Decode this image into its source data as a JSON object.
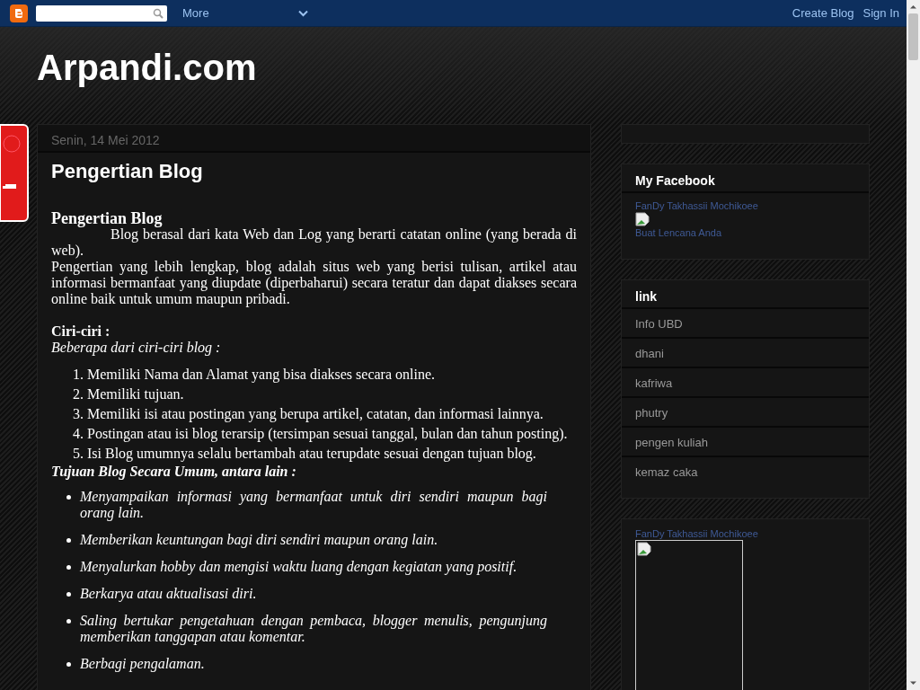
{
  "navbar": {
    "more": "More",
    "create_blog": "Create Blog",
    "sign_in": "Sign In"
  },
  "header": {
    "title": "Arpandi.com"
  },
  "post": {
    "date": "Senin, 14 Mei 2012",
    "title": "Pengertian Blog",
    "heading": "Pengertian Blog",
    "intro": "Blog berasal dari kata Web dan Log yang berarti catatan online (yang berada di web).",
    "paragraph": "Pengertian yang lebih lengkap, blog adalah situs web yang berisi tulisan, artikel atau informasi bermanfaat yang diupdate (diperbaharui) secara teratur dan dapat diakses secara online baik untuk umum maupun pribadi.",
    "features_heading": "Ciri-ciri :",
    "features_intro": "Beberapa dari ciri-ciri blog :",
    "features": [
      {
        "number": "1.",
        "text": "Memiliki Nama dan Alamat yang bisa diakses secara online."
      },
      {
        "number": "2.",
        "text": "Memiliki tujuan."
      },
      {
        "number": "3.",
        "text": "Memiliki isi atau postingan yang berupa artikel, catatan, dan informasi lainnya."
      },
      {
        "number": "4.",
        "text": "Postingan atau isi blog terarsip (tersimpan sesuai tanggal, bulan dan tahun posting)."
      },
      {
        "number": "5.",
        "text": "Isi Blog umumnya selalu bertambah atau terupdate sesuai dengan tujuan blog."
      }
    ],
    "goals_heading": "Tujuan Blog Secara Umum, antara lain :",
    "goals": [
      "Menyampaikan informasi yang bermanfaat untuk diri sendiri maupun bagi orang lain.",
      "Memberikan keuntungan bagi diri sendiri maupun orang lain.",
      "Menyalurkan hobby dan mengisi waktu luang dengan kegiatan yang positif.",
      "Berkarya atau aktualisasi diri.",
      "Saling bertukar pengetahuan dengan pembaca, blogger menulis, pengunjung memberikan tanggapan atau komentar.",
      "Berbagi pengalaman."
    ]
  },
  "sidebar": {
    "facebook": {
      "title": "My Facebook",
      "name": "FanDy Takhassii Mochikoee",
      "badge_link": "Buat Lencana Anda"
    },
    "links": {
      "title": "link",
      "items": [
        "Info UBD",
        "dhani",
        "kafriwa",
        "phutry",
        "pengen kuliah",
        "kemaz caka"
      ]
    },
    "profile": {
      "name": "FanDy Takhassii Mochikoee"
    }
  }
}
